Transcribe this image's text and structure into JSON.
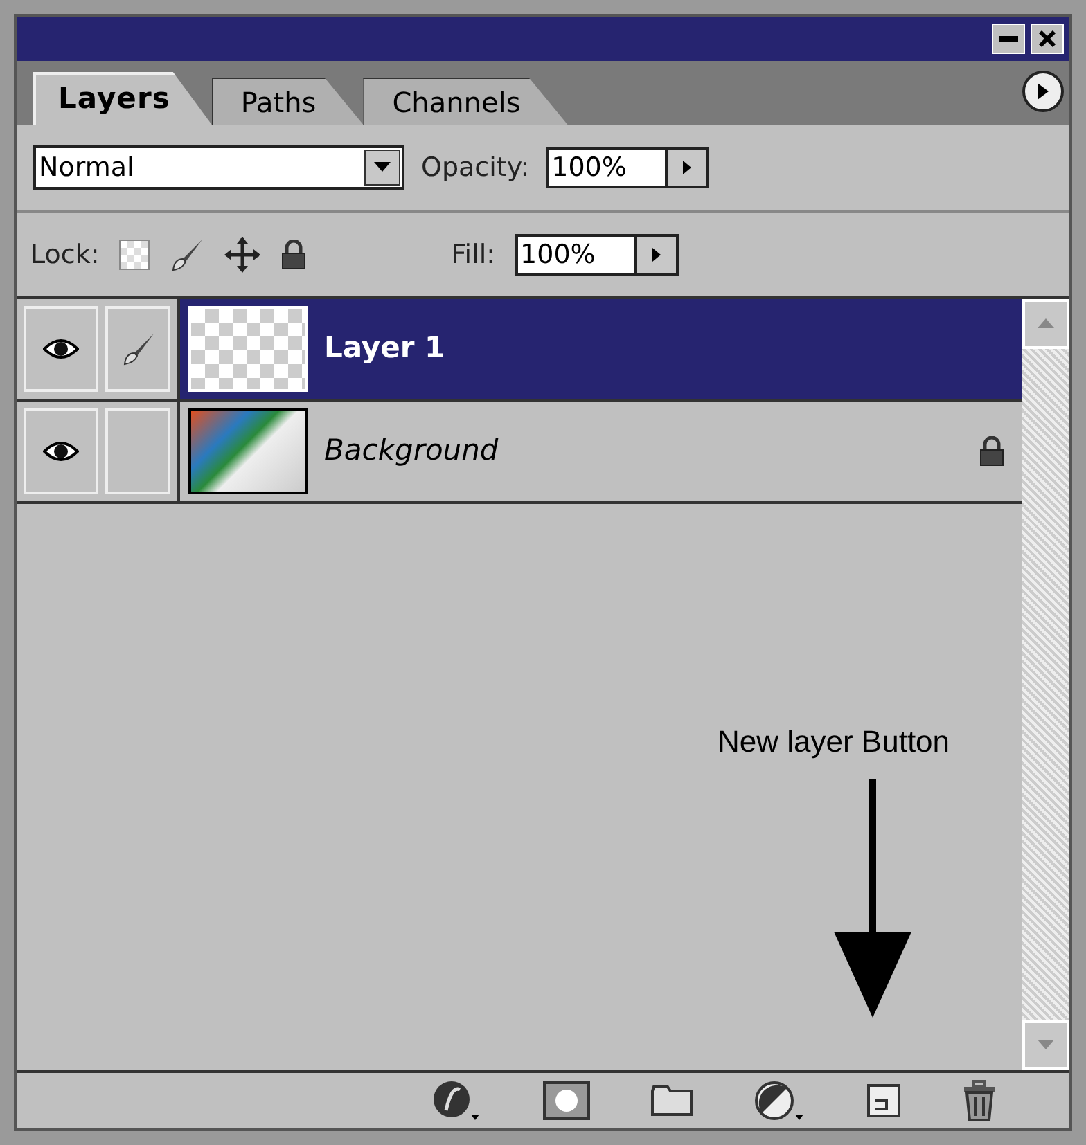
{
  "tabs": [
    {
      "label": "Layers",
      "selected": true
    },
    {
      "label": "Paths",
      "selected": false
    },
    {
      "label": "Channels",
      "selected": false
    }
  ],
  "blend_mode": {
    "value": "Normal"
  },
  "opacity": {
    "label": "Opacity:",
    "value": "100%"
  },
  "lock": {
    "label": "Lock:"
  },
  "fill": {
    "label": "Fill:",
    "value": "100%"
  },
  "layers": [
    {
      "name": "Layer 1",
      "selected": true,
      "visible": true,
      "paint_active": true,
      "locked": false,
      "kind": "transparent"
    },
    {
      "name": "Background",
      "selected": false,
      "visible": true,
      "paint_active": false,
      "locked": true,
      "kind": "background"
    }
  ],
  "annotation": {
    "text": "New layer Button"
  }
}
